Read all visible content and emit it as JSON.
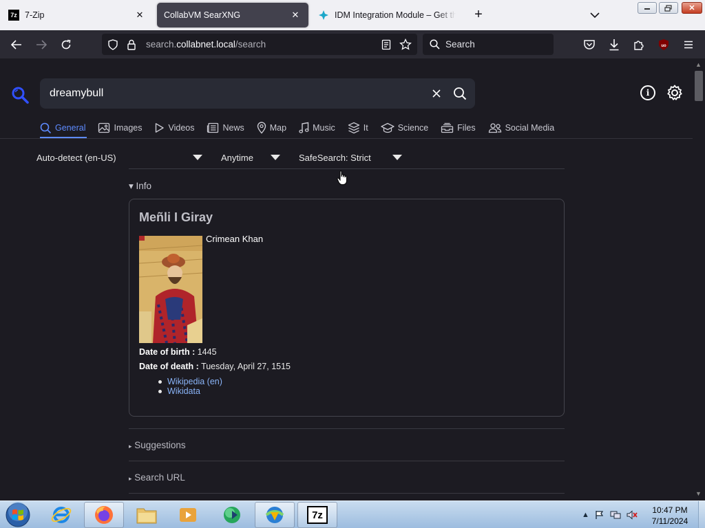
{
  "browser": {
    "tabs": [
      {
        "title": "7-Zip",
        "favicon": "7z"
      },
      {
        "title": "CollabVM SearXNG"
      },
      {
        "title": "IDM Integration Module – Get th"
      }
    ],
    "url": {
      "prefix": "search.",
      "host": "collabnet.local",
      "path": "/search"
    },
    "search_placeholder": "Search"
  },
  "search": {
    "query": "dreamybull",
    "categories": [
      {
        "label": "General",
        "icon": "search-icon"
      },
      {
        "label": "Images",
        "icon": "image-icon"
      },
      {
        "label": "Videos",
        "icon": "play-icon"
      },
      {
        "label": "News",
        "icon": "newspaper-icon"
      },
      {
        "label": "Map",
        "icon": "map-pin-icon"
      },
      {
        "label": "Music",
        "icon": "music-icon"
      },
      {
        "label": "It",
        "icon": "layers-icon"
      },
      {
        "label": "Science",
        "icon": "school-icon"
      },
      {
        "label": "Files",
        "icon": "file-tray-icon"
      },
      {
        "label": "Social Media",
        "icon": "people-icon"
      }
    ],
    "active_category": "General",
    "filters": {
      "language": "Auto-detect (en-US)",
      "time": "Anytime",
      "safesearch": "SafeSearch: Strict"
    }
  },
  "infobox": {
    "toggle_label": "Info",
    "title": "Meñli I Giray",
    "description": "Crimean Khan",
    "attributes": [
      {
        "label": "Date of birth :",
        "value": "1445"
      },
      {
        "label": "Date of death :",
        "value": "Tuesday, April 27, 1515"
      }
    ],
    "links": [
      "Wikipedia (en)",
      "Wikidata"
    ]
  },
  "sections": {
    "suggestions": "Suggestions",
    "search_url": "Search URL"
  },
  "taskbar": {
    "time": "10:47 PM",
    "date": "7/11/2024",
    "seven_zip_label": "7z"
  },
  "colors": {
    "accent": "#5e8bff",
    "link": "#8ab4f8",
    "page_bg": "#1c1b22",
    "searchbox_bg": "#292b35"
  }
}
